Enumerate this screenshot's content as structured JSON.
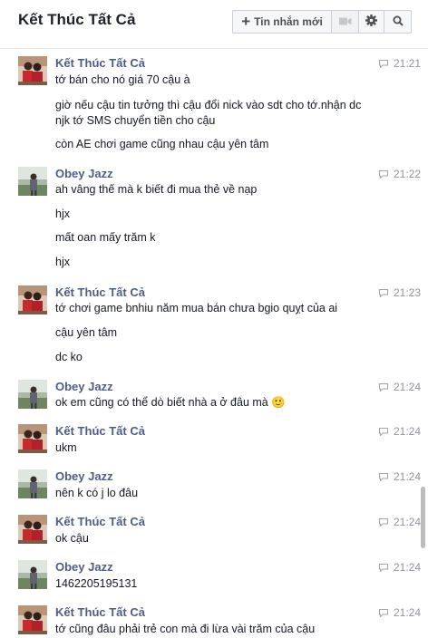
{
  "header": {
    "title": "Kết Thúc Tất Cả",
    "new_message_label": "Tin nhắn mới",
    "icons": [
      "plus-icon",
      "video-camera-icon",
      "gear-icon",
      "search-icon"
    ]
  },
  "messages": [
    {
      "sender": "Kết Thúc Tất Cả",
      "time": "21:21",
      "lines": [
        "tớ bán cho nó giá 70 cậu à",
        "giờ nếu cậu tin tưởng thì cậu đổi nick vào sdt cho tớ.nhận dc",
        "njk tớ SMS chuyển tiền cho cậu",
        "còn AE chơi game cũng nhau cậu yên tâm"
      ]
    },
    {
      "sender": "Obey Jazz",
      "time": "21:22",
      "lines": [
        "ah vâng thế mà k biết đi mua thẻ về nạp",
        "hjx",
        "mất oan mấy trăm k",
        "hjx"
      ]
    },
    {
      "sender": "Kết Thúc Tất Cả",
      "time": "21:23",
      "lines": [
        "tớ chơi game bnhiu năm mua bán chưa bgio quỵt của ai",
        "cậu yên tâm",
        "dc ko"
      ]
    },
    {
      "sender": "Obey Jazz",
      "time": "21:24",
      "lines": [
        "ok em cũng có thể dò biết nhà a ở đâu mà 🙂"
      ]
    },
    {
      "sender": "Kết Thúc Tất Cả",
      "time": "21:24",
      "lines": [
        "ukm"
      ]
    },
    {
      "sender": "Obey Jazz",
      "time": "21:24",
      "lines": [
        "nên k có j lo đâu"
      ]
    },
    {
      "sender": "Kết Thúc Tất Cả",
      "time": "21:24",
      "lines": [
        "ok cậu"
      ]
    },
    {
      "sender": "Obey Jazz",
      "time": "21:24",
      "lines": [
        "1462205195131"
      ]
    },
    {
      "sender": "Kết Thúc Tất Cả",
      "time": "21:24",
      "lines": [
        "tớ cũng đâu phải trẻ con mà đi lừa vài trăm của cậu"
      ]
    }
  ]
}
